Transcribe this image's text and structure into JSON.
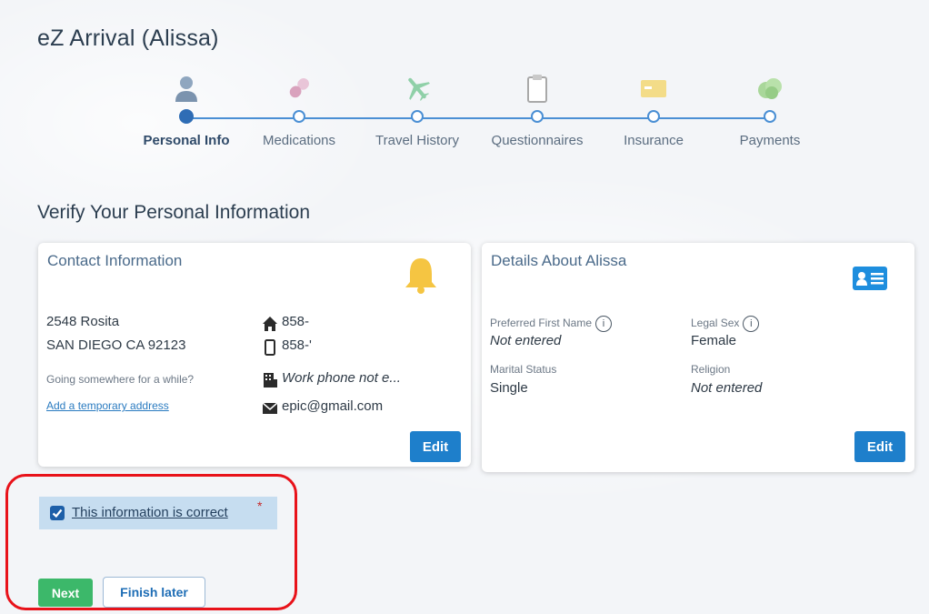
{
  "app": {
    "title": "eZ Arrival  (Alissa)"
  },
  "stepper": {
    "steps": [
      {
        "label": "Personal Info",
        "icon": "person-icon",
        "active": true
      },
      {
        "label": "Medications",
        "icon": "pill-icon",
        "active": false
      },
      {
        "label": "Travel History",
        "icon": "airplane-icon",
        "active": false
      },
      {
        "label": "Questionnaires",
        "icon": "clipboard-icon",
        "active": false
      },
      {
        "label": "Insurance",
        "icon": "insurance-card-icon",
        "active": false
      },
      {
        "label": "Payments",
        "icon": "money-icon",
        "active": false
      }
    ]
  },
  "section": {
    "title": "Verify Your Personal Information"
  },
  "contact_card": {
    "title": "Contact Information",
    "bell_icon": "bell-icon",
    "address_line1": "2548 Rosita",
    "address_line2": "SAN DIEGO CA 92123",
    "temp_prompt": "Going somewhere for a while?",
    "temp_link": "Add a temporary address",
    "home_phone": "858-",
    "mobile_phone": "858-'",
    "work_phone": "Work phone not e...",
    "email": "epic@gmail.com",
    "edit_label": "Edit"
  },
  "details_card": {
    "title": "Details About Alissa",
    "id_card_icon": "id-card-icon",
    "preferred_name_label": "Preferred First Name",
    "preferred_name_value": "Not entered",
    "legal_sex_label": "Legal Sex",
    "legal_sex_value": "Female",
    "marital_label": "Marital Status",
    "marital_value": "Single",
    "religion_label": "Religion",
    "religion_value": "Not entered",
    "info_glyph": "i",
    "edit_label": "Edit"
  },
  "confirm": {
    "label": "This information is correct",
    "required_mark": "*",
    "checked": true
  },
  "actions": {
    "next_label": "Next",
    "finish_later_label": "Finish later"
  },
  "colors": {
    "accent": "#1e7fcb",
    "next_green": "#3cb86a",
    "highlight_red": "#e8121a",
    "confirm_bg": "#c6ddf0"
  }
}
